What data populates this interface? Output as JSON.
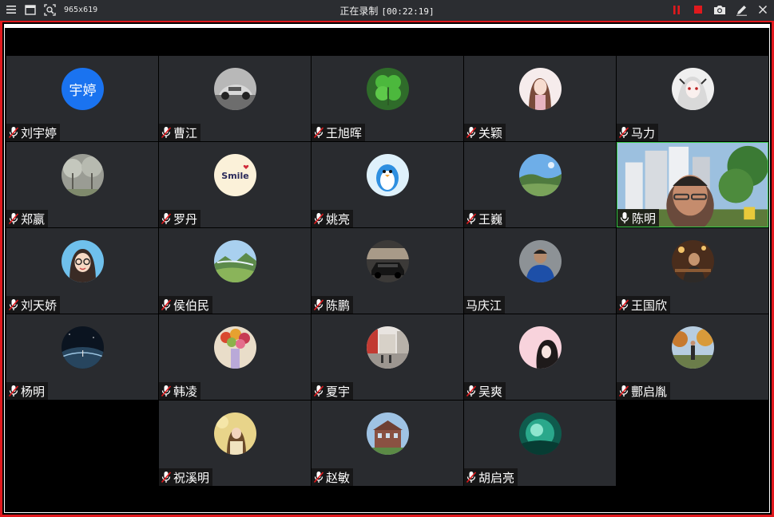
{
  "toolbar": {
    "resolution": "965x619",
    "status": "正在录制",
    "timer": "[00:22:19]",
    "icons": [
      "menu-icon",
      "window-icon",
      "region-select-icon",
      "pause-icon",
      "stop-icon",
      "camera-icon",
      "pen-icon",
      "close-icon"
    ],
    "colors": {
      "record": "#e0191d",
      "frame": "#e0191d"
    }
  },
  "participants": [
    {
      "name": "刘宇婷",
      "avatar_text": "宇婷",
      "muted": true
    },
    {
      "name": "曹江",
      "avatar": "car-photo",
      "muted": true
    },
    {
      "name": "王旭晖",
      "avatar": "clover-photo",
      "muted": true
    },
    {
      "name": "关颖",
      "avatar": "cartoon-girl",
      "muted": true
    },
    {
      "name": "马力",
      "avatar": "anime-girl",
      "muted": true
    },
    {
      "name": "郑嬴",
      "avatar": "trees-photo",
      "muted": true
    },
    {
      "name": "罗丹",
      "avatar": "smile-logo",
      "avatar_label": "Smile",
      "muted": true
    },
    {
      "name": "姚亮",
      "avatar": "penguin-cartoon",
      "muted": true
    },
    {
      "name": "王巍",
      "avatar": "landscape-photo",
      "muted": true
    },
    {
      "name": "陈明",
      "video": true,
      "active": true,
      "muted": false
    },
    {
      "name": "刘天娇",
      "avatar": "cartoon-glasses",
      "muted": true
    },
    {
      "name": "侯伯民",
      "avatar": "mountain-photo",
      "muted": true
    },
    {
      "name": "陈鹏",
      "avatar": "suv-photo",
      "muted": true
    },
    {
      "name": "马庆江",
      "avatar": "person-photo",
      "muted": false,
      "no_mic_icon": true
    },
    {
      "name": "王国欣",
      "avatar": "restaurant-photo",
      "muted": true
    },
    {
      "name": "杨明",
      "avatar": "planet-photo",
      "muted": true
    },
    {
      "name": "韩凌",
      "avatar": "flowers-photo",
      "muted": true
    },
    {
      "name": "夏宇",
      "avatar": "street-photo",
      "muted": true
    },
    {
      "name": "吴爽",
      "avatar": "pink-girl",
      "muted": true
    },
    {
      "name": "酆启胤",
      "avatar": "park-photo",
      "muted": true
    },
    {
      "name": "祝溪明",
      "avatar": "girl-yellow",
      "muted": true
    },
    {
      "name": "赵敏",
      "avatar": "building-photo",
      "muted": true
    },
    {
      "name": "胡启亮",
      "avatar": "teal-light",
      "muted": true
    }
  ]
}
